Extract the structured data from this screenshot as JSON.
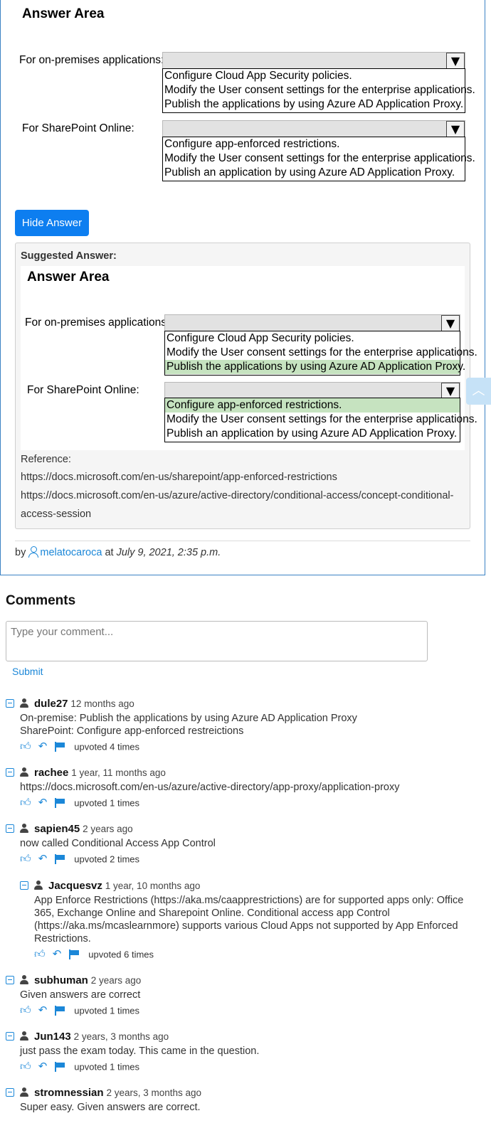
{
  "question": {
    "answer_area_title": "Answer Area",
    "row1_label": "For on-premises applications:",
    "row1_options": [
      "Configure Cloud App Security policies.",
      "Modify the User consent settings for the enterprise applications.",
      "Publish the applications by using Azure AD Application Proxy."
    ],
    "row2_label": "For SharePoint Online:",
    "row2_options": [
      "Configure app-enforced restrictions.",
      "Modify the User consent settings for the enterprise applications.",
      "Publish an application by using Azure AD Application Proxy."
    ],
    "dropdown_arrow": "▼"
  },
  "hide_answer_label": "Hide Answer",
  "suggested": {
    "label": "Suggested Answer:",
    "answer_area_title": "Answer Area",
    "row1_label": "For on-premises applications:",
    "row1_options": [
      "Configure Cloud App Security policies.",
      "Modify the User consent settings for the enterprise applications.",
      "Publish the applications by using Azure AD Application Proxy."
    ],
    "row1_selected_index": 2,
    "row2_label": "For SharePoint Online:",
    "row2_options": [
      "Configure app-enforced restrictions.",
      "Modify the User consent settings for the enterprise applications.",
      "Publish an application by using Azure AD Application Proxy."
    ],
    "row2_selected_index": 0,
    "highlight_color": "#c6e3c0",
    "reference_label": "Reference:",
    "reference_links": [
      "https://docs.microsoft.com/en-us/sharepoint/app-enforced-restrictions",
      "https://docs.microsoft.com/en-us/azure/active-directory/conditional-access/concept-conditional-",
      "access-session"
    ]
  },
  "byline": {
    "prefix": "by",
    "author": "melatocaroca",
    "at": "at",
    "date": "July 9, 2021, 2:35 p.m."
  },
  "scroll_top_icon": "︿",
  "comments": {
    "heading": "Comments",
    "input_placeholder": "Type your comment...",
    "submit_label": "Submit",
    "items": [
      {
        "user": "dule27",
        "time": "12 months ago",
        "lines": [
          "On-premise: Publish the applications by using Azure AD Application Proxy",
          "SharePoint: Configure app-enforced restreictions"
        ],
        "upvotes": "upvoted 4 times"
      },
      {
        "user": "rachee",
        "time": "1 year, 11 months ago",
        "lines": [
          "https://docs.microsoft.com/en-us/azure/active-directory/app-proxy/application-proxy"
        ],
        "upvotes": "upvoted 1 times"
      },
      {
        "user": "sapien45",
        "time": "2 years ago",
        "lines": [
          "now called Conditional Access App Control"
        ],
        "upvotes": "upvoted 2 times"
      },
      {
        "user": "Jacquesvz",
        "time": "1 year, 10 months ago",
        "lines": [
          "App Enforce Restrictions (https://aka.ms/caapprestrictions) are for supported apps only: Office",
          "365, Exchange Online and Sharepoint Online. Conditional access app Control",
          "(https://aka.ms/mcaslearnmore) supports various Cloud Apps not supported by App Enforced",
          "Restrictions."
        ],
        "upvotes": "upvoted 6 times"
      },
      {
        "user": "subhuman",
        "time": "2 years ago",
        "lines": [
          "Given answers are correct"
        ],
        "upvotes": "upvoted 1 times"
      },
      {
        "user": "Jun143",
        "time": "2 years, 3 months ago",
        "lines": [
          "just pass the exam today. This came in the question."
        ],
        "upvotes": "upvoted 1 times"
      },
      {
        "user": "stromnessian",
        "time": "2 years, 3 months ago",
        "lines": [
          "Super easy. Given answers are correct."
        ],
        "upvotes": ""
      }
    ]
  },
  "accent_color": "#1b87d8",
  "button_color": "#0d7ef0"
}
